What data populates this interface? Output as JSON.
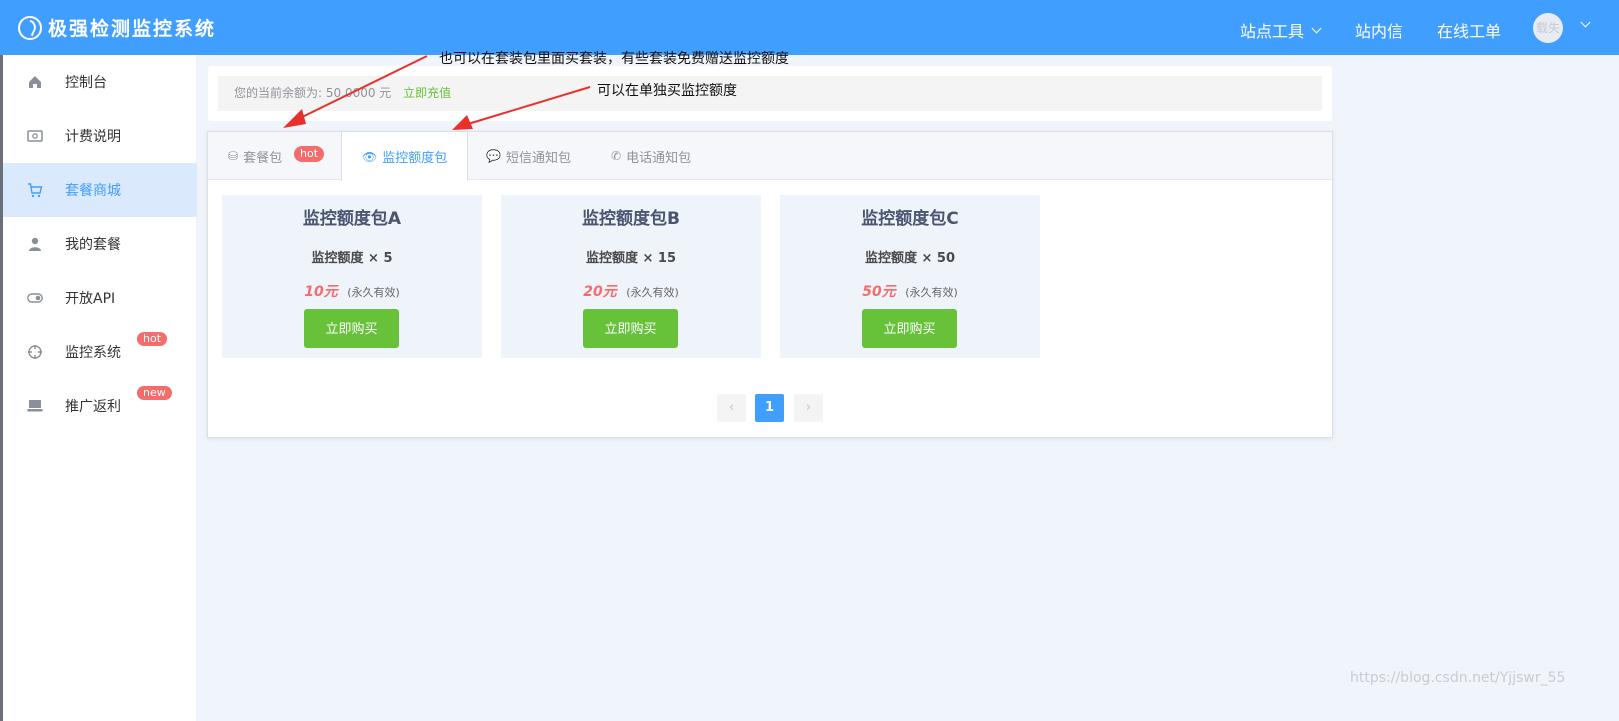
{
  "header": {
    "title": "极强检测监控系统",
    "nav": {
      "tools": "站点工具",
      "messages": "站内信",
      "tickets": "在线工单"
    },
    "user": "载失"
  },
  "sidebar": {
    "items": [
      {
        "label": "控制台",
        "icon": "home-icon"
      },
      {
        "label": "计费说明",
        "icon": "billing-icon"
      },
      {
        "label": "套餐商城",
        "icon": "cart-icon",
        "active": true
      },
      {
        "label": "我的套餐",
        "icon": "user-icon"
      },
      {
        "label": "开放API",
        "icon": "toggle-icon"
      },
      {
        "label": "监控系统",
        "icon": "crosshair-icon",
        "badge": "hot"
      },
      {
        "label": "推广返利",
        "icon": "laptop-icon",
        "badge": "new"
      }
    ]
  },
  "balance": {
    "text": "您的当前余额为: 50.0000 元",
    "recharge": "立即充值"
  },
  "tabs": [
    {
      "label": "套餐包",
      "badge": "hot"
    },
    {
      "label": "监控额度包",
      "active": true
    },
    {
      "label": "短信通知包"
    },
    {
      "label": "电话通知包"
    }
  ],
  "packages": [
    {
      "title": "监控额度包A",
      "quota": "监控额度 × 5",
      "price": "10元",
      "validity": "(永久有效)",
      "button": "立即购买"
    },
    {
      "title": "监控额度包B",
      "quota": "监控额度 × 15",
      "price": "20元",
      "validity": "(永久有效)",
      "button": "立即购买"
    },
    {
      "title": "监控额度包C",
      "quota": "监控额度 × 50",
      "price": "50元",
      "validity": "(永久有效)",
      "button": "立即购买"
    }
  ],
  "pagination": {
    "prev": "‹",
    "current": "1",
    "next": "›"
  },
  "annotations": {
    "note1": "也可以在套装包里面买套装，有些套装免费赠送监控额度",
    "note2": "可以在单独买监控额度"
  },
  "watermark": "https://blog.csdn.net/Yjjswr_55",
  "colors": {
    "primary": "#409eff",
    "success": "#67c23a",
    "danger": "#f56c6c",
    "arrow": "#e8312a"
  }
}
